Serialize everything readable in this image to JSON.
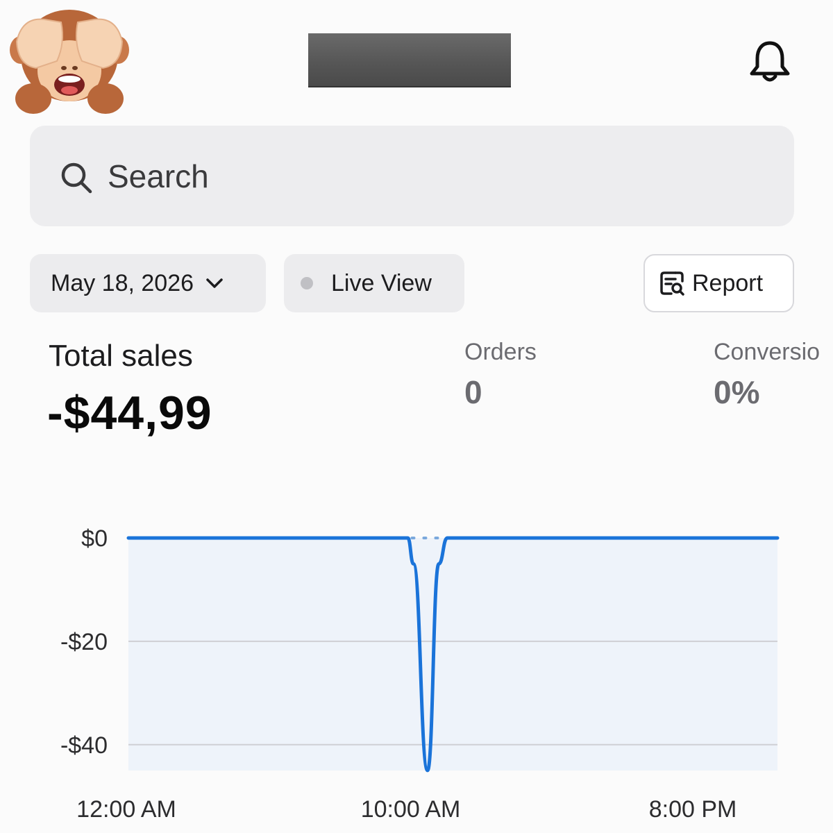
{
  "header": {
    "avatar": "see-no-evil-monkey-emoji",
    "title_redacted": true,
    "notifications_icon": "bell-icon"
  },
  "search": {
    "placeholder": "Search",
    "icon": "search-icon"
  },
  "filters": {
    "date_label": "May 18, 2026",
    "live_label": "Live View",
    "report_label": "Report"
  },
  "metrics": {
    "total_sales_label": "Total sales",
    "total_sales_value": "-$44,99",
    "orders_label": "Orders",
    "orders_value": "0",
    "conversion_label": "Conversio",
    "conversion_value": "0%"
  },
  "colors": {
    "line": "#1a73d9",
    "area": "#eef3fa",
    "grid": "#cfcfd4"
  },
  "chart_data": {
    "type": "area",
    "title": "",
    "xlabel": "",
    "ylabel": "",
    "y_tick_labels": [
      "$0",
      "-$20",
      "-$40"
    ],
    "y_ticks": [
      0,
      -20,
      -40
    ],
    "ylim": [
      -45,
      0
    ],
    "x_tick_labels": [
      "12:00 AM",
      "10:00 AM",
      "8:00 PM"
    ],
    "x_ticks": [
      0,
      10,
      20
    ],
    "xlim": [
      0,
      23
    ],
    "series": [
      {
        "x": [
          0,
          9.9,
          10.1,
          10.6,
          11.0,
          11.3,
          23
        ],
        "values": [
          0,
          0,
          -5,
          -44.99,
          -5,
          0,
          0
        ]
      }
    ],
    "grid": true
  }
}
